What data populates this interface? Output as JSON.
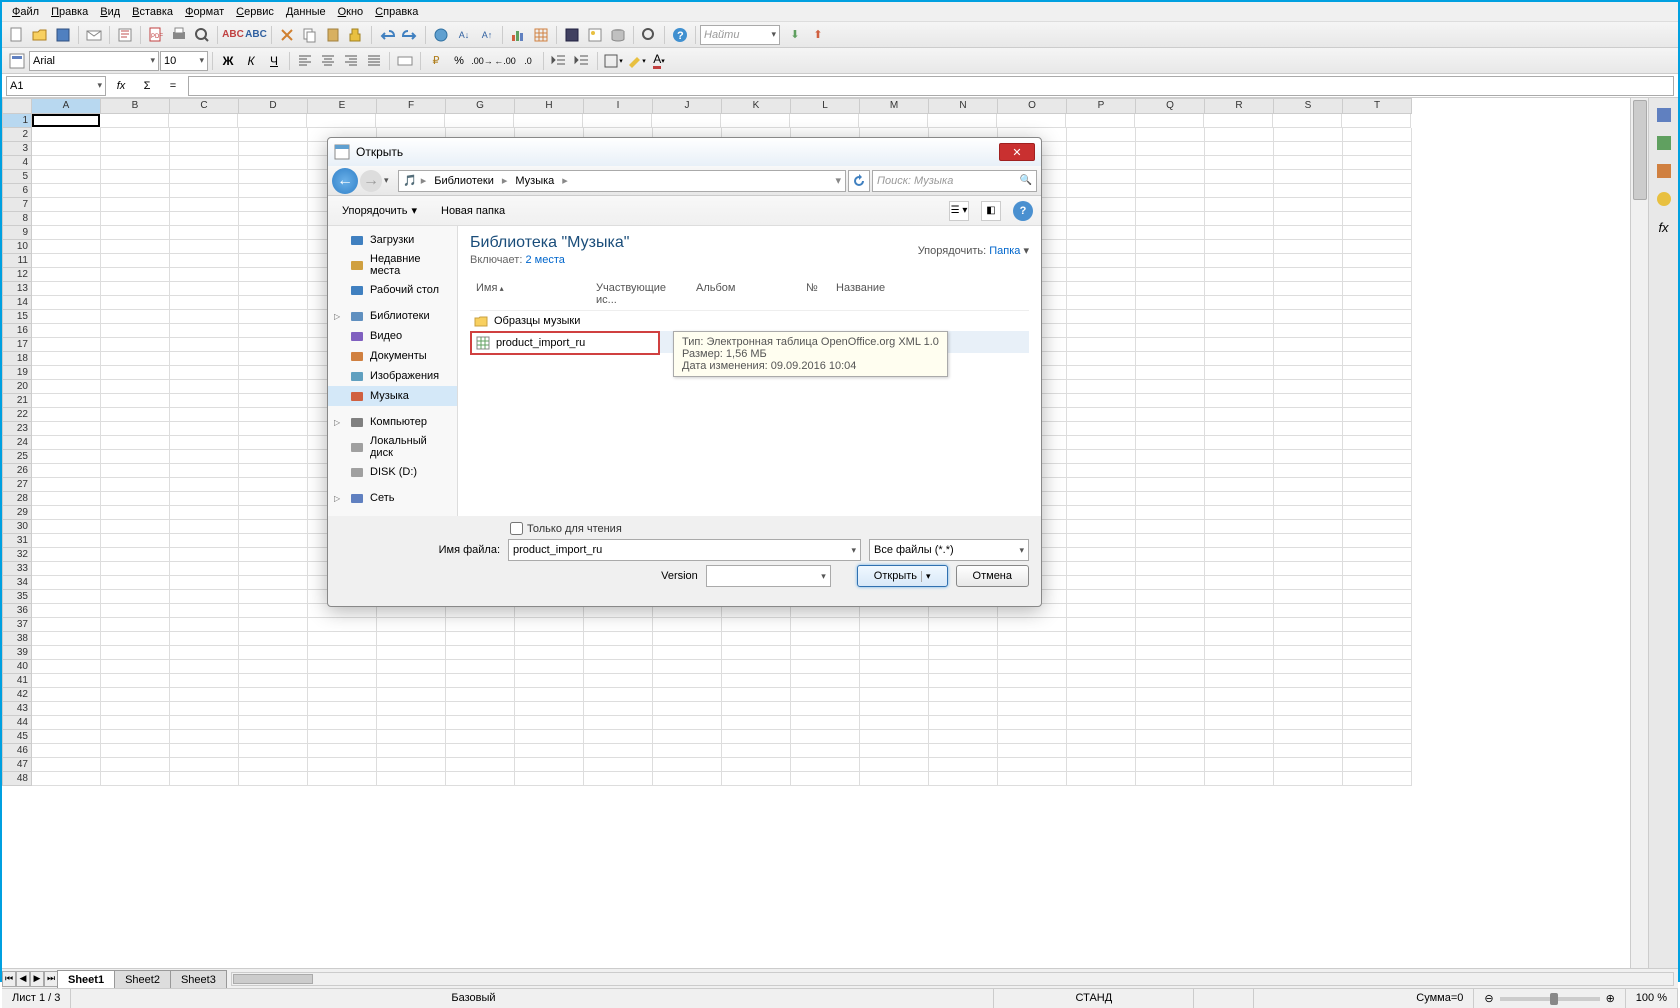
{
  "menu": [
    "Файл",
    "Правка",
    "Вид",
    "Вставка",
    "Формат",
    "Сервис",
    "Данные",
    "Окно",
    "Справка"
  ],
  "toolbar1": {
    "find_placeholder": "Найти"
  },
  "toolbar2": {
    "font": "Arial",
    "size": "10"
  },
  "formula": {
    "cell": "A1",
    "fx": "fx",
    "sigma": "Σ",
    "eq": "="
  },
  "columns": [
    "A",
    "B",
    "C",
    "D",
    "E",
    "F",
    "G",
    "H",
    "I",
    "J",
    "K",
    "L",
    "M",
    "N",
    "O",
    "P",
    "Q",
    "R",
    "S",
    "T"
  ],
  "rows": [
    1,
    2,
    3,
    4,
    5,
    6,
    7,
    8,
    9,
    10,
    11,
    12,
    13,
    14,
    15,
    16,
    17,
    18,
    19,
    20,
    21,
    22,
    23,
    24,
    25,
    26,
    27,
    28,
    29,
    30,
    31,
    32,
    33,
    34,
    35,
    36,
    37,
    38,
    39,
    40,
    41,
    42,
    43,
    44,
    45,
    46,
    47,
    48
  ],
  "sheet_tabs": [
    "Sheet1",
    "Sheet2",
    "Sheet3"
  ],
  "status": {
    "sheet": "Лист 1 / 3",
    "style": "Базовый",
    "caps": "СТАНД",
    "sum": "Сумма=0",
    "zoom": "100 %"
  },
  "dialog": {
    "title": "Открыть",
    "breadcrumb": [
      "Библиотеки",
      "Музыка"
    ],
    "search_placeholder": "Поиск: Музыка",
    "organize": "Упорядочить",
    "new_folder": "Новая папка",
    "sidebar": [
      {
        "label": "Загрузки",
        "indent": 1
      },
      {
        "label": "Недавние места",
        "indent": 1
      },
      {
        "label": "Рабочий стол",
        "indent": 1
      },
      {
        "label": "Библиотеки",
        "indent": 0,
        "expandable": true
      },
      {
        "label": "Видео",
        "indent": 1
      },
      {
        "label": "Документы",
        "indent": 1
      },
      {
        "label": "Изображения",
        "indent": 1
      },
      {
        "label": "Музыка",
        "indent": 1,
        "selected": true
      },
      {
        "label": "Компьютер",
        "indent": 0,
        "expandable": true
      },
      {
        "label": "Локальный диск",
        "indent": 1
      },
      {
        "label": "DISK (D:)",
        "indent": 1
      },
      {
        "label": "Сеть",
        "indent": 0,
        "expandable": true
      }
    ],
    "main": {
      "title": "Библиотека \"Музыка\"",
      "includes_label": "Включает:",
      "includes_link": "2 места",
      "sort_label": "Упорядочить:",
      "sort_value": "Папка",
      "headers": {
        "name": "Имя",
        "artists": "Участвующие ис...",
        "album": "Альбом",
        "num": "№",
        "title": "Название"
      },
      "items": [
        {
          "name": "Образцы музыки",
          "type": "folder"
        },
        {
          "name": "product_import_ru",
          "type": "file",
          "selected": true
        }
      ],
      "tooltip": {
        "line1": "Тип: Электронная таблица OpenOffice.org XML 1.0",
        "line2": "Размер: 1,56 МБ",
        "line3": "Дата изменения: 09.09.2016 10:04"
      }
    },
    "readonly_label": "Только для чтения",
    "filename_label": "Имя файла:",
    "filename_value": "product_import_ru",
    "filter_value": "Все файлы (*.*)",
    "version_label": "Version",
    "open_btn": "Открыть",
    "cancel_btn": "Отмена"
  }
}
